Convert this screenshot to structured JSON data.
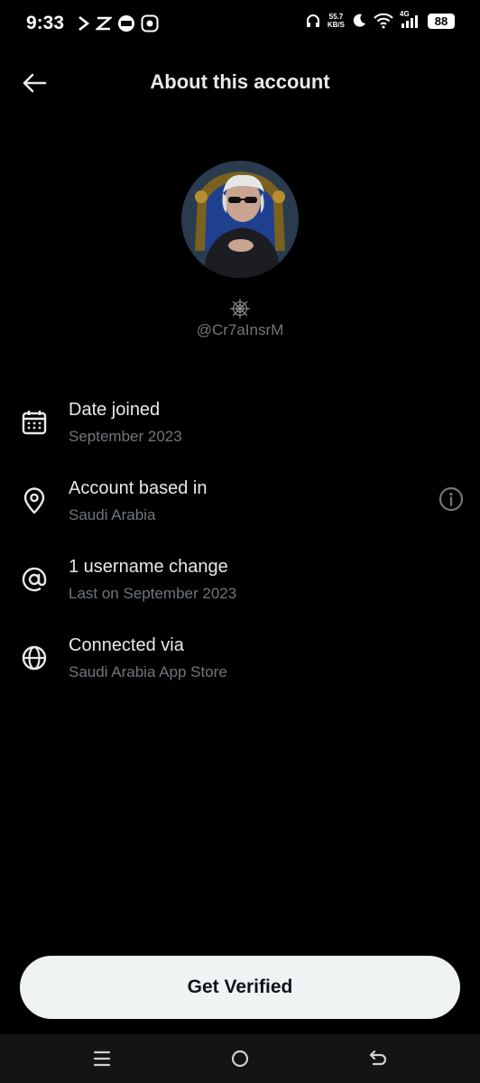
{
  "status_bar": {
    "time": "9:33",
    "left_icons": [
      "capcut-icon",
      "mark-icon",
      "ad-icon",
      "app-icon"
    ],
    "net_speed_value": "55.7",
    "net_speed_unit": "KB/S",
    "network": "4G",
    "battery": "88"
  },
  "header": {
    "title": "About this account"
  },
  "profile": {
    "handle": "@Cr7aInsrM",
    "badge_icon": "spider-web-icon"
  },
  "info": {
    "items": [
      {
        "icon": "calendar-icon",
        "title": "Date joined",
        "subtitle": "September 2023"
      },
      {
        "icon": "location-icon",
        "title": "Account based in",
        "subtitle": "Saudi Arabia"
      },
      {
        "icon": "at-icon",
        "title": "1 username change",
        "subtitle": "Last on September 2023"
      },
      {
        "icon": "globe-icon",
        "title": "Connected via",
        "subtitle": "Saudi Arabia App Store"
      }
    ]
  },
  "actions": {
    "verify_label": "Get Verified"
  },
  "nav": {
    "items": [
      "menu-icon",
      "home-icon",
      "back-icon"
    ]
  },
  "colors": {
    "background": "#000000",
    "primary_text": "#e7e9ea",
    "secondary_text": "#71767b",
    "button_bg": "#eff3f4",
    "button_text": "#0f1419"
  }
}
